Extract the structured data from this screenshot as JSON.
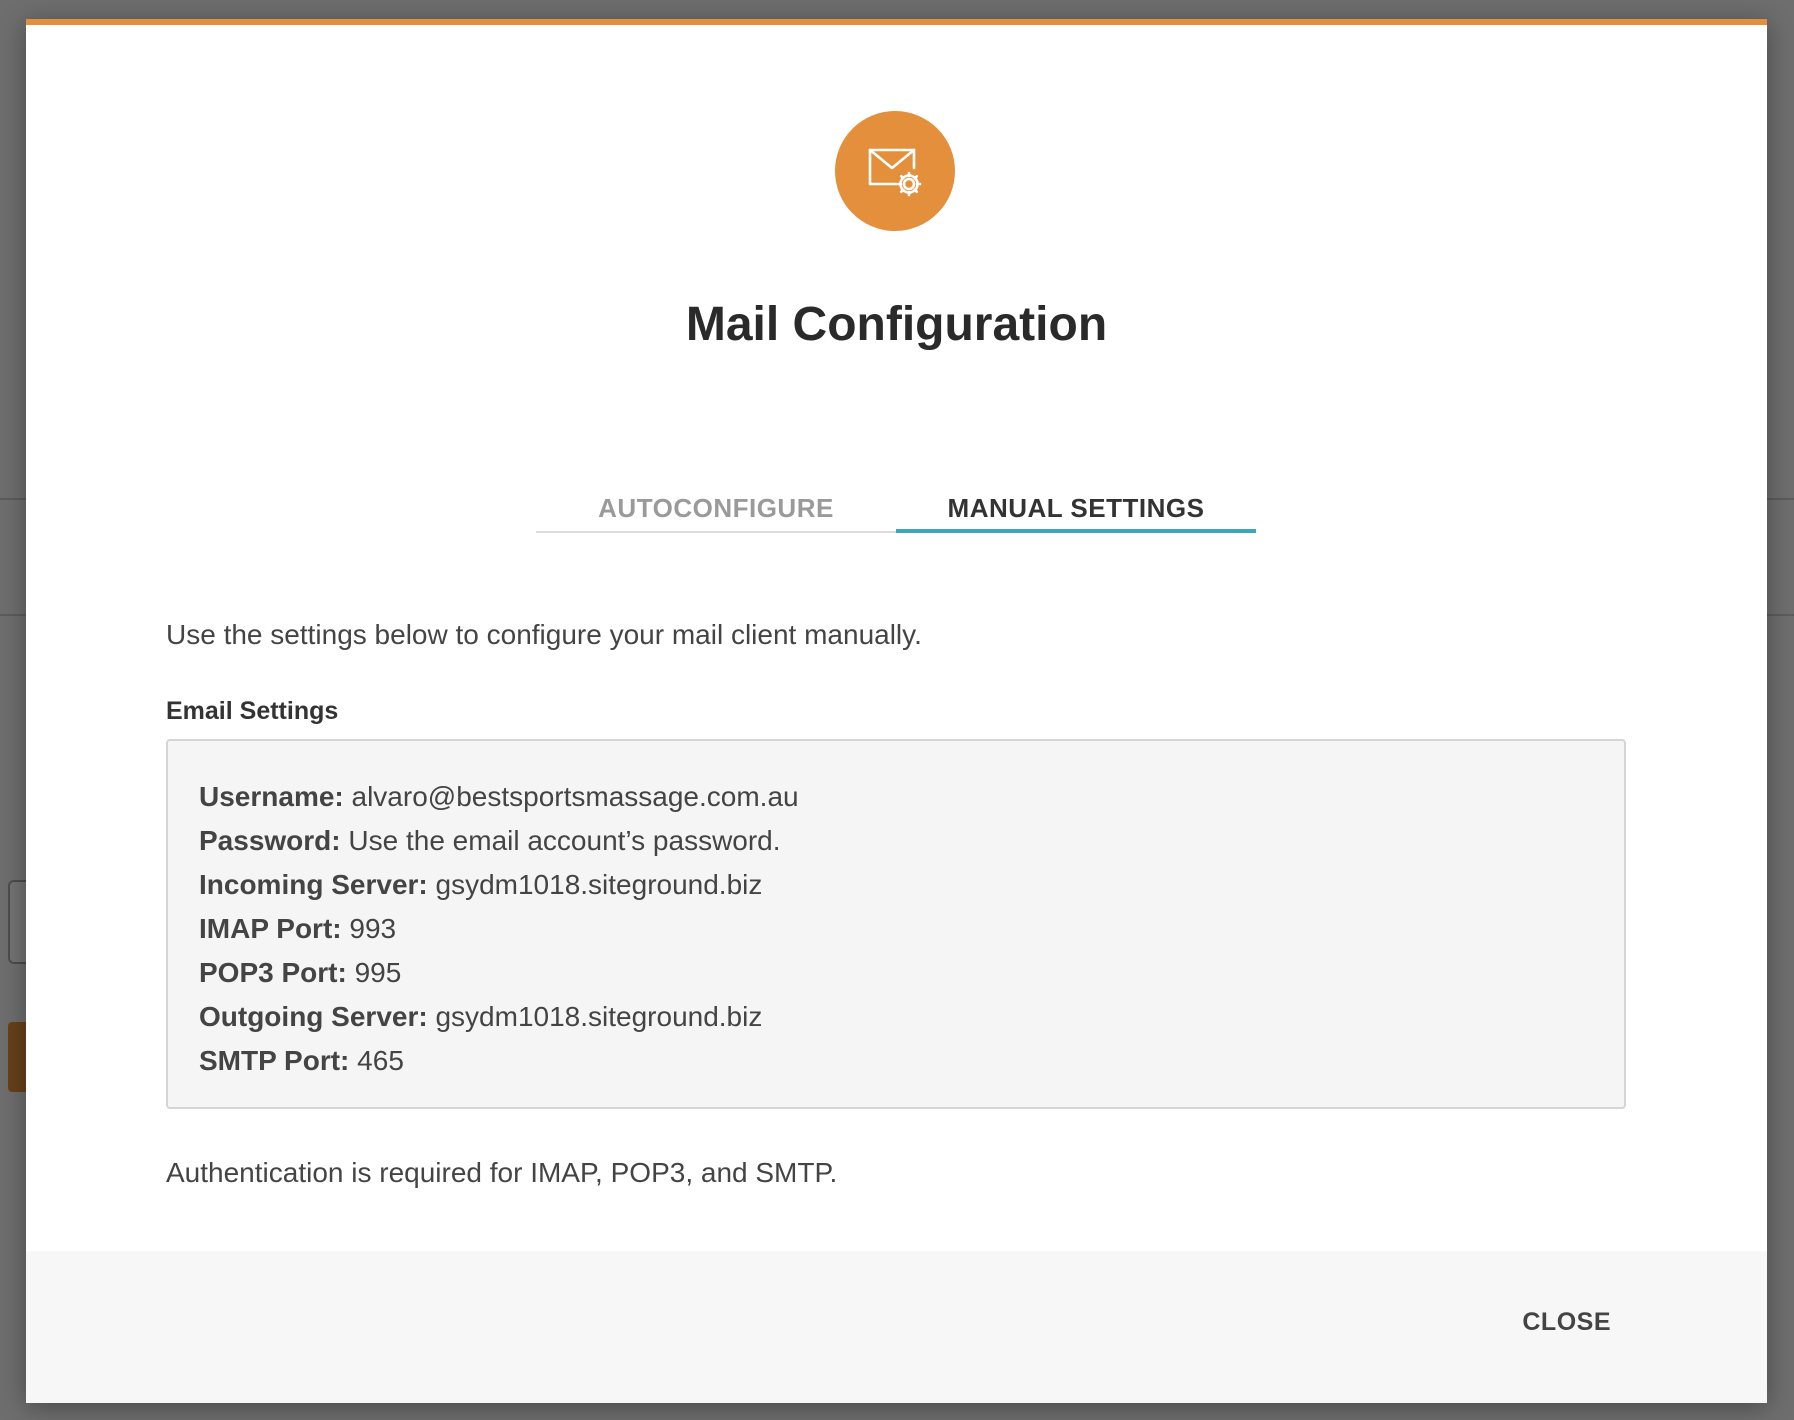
{
  "modal": {
    "title": "Mail Configuration",
    "icon": "mail-gear-icon",
    "accent_color": "#e48f3c",
    "tab_indicator_color": "#3aa7bc",
    "tabs": [
      {
        "label": "AUTOCONFIGURE",
        "active": false
      },
      {
        "label": "MANUAL SETTINGS",
        "active": true
      }
    ],
    "intro": "Use the settings below to configure your mail client manually.",
    "section_label": "Email Settings",
    "settings": [
      {
        "key": "Username:",
        "value": "alvaro@bestsportsmassage.com.au"
      },
      {
        "key": "Password:",
        "value": "Use the email account’s password."
      },
      {
        "key": "Incoming Server:",
        "value": "gsydm1018.siteground.biz"
      },
      {
        "key": "IMAP Port:",
        "value": "993"
      },
      {
        "key": "POP3 Port:",
        "value": "995"
      },
      {
        "key": "Outgoing Server:",
        "value": "gsydm1018.siteground.biz"
      },
      {
        "key": "SMTP Port:",
        "value": "465"
      }
    ],
    "auth_note": "Authentication is required for IMAP, POP3, and SMTP.",
    "close_label": "CLOSE"
  }
}
